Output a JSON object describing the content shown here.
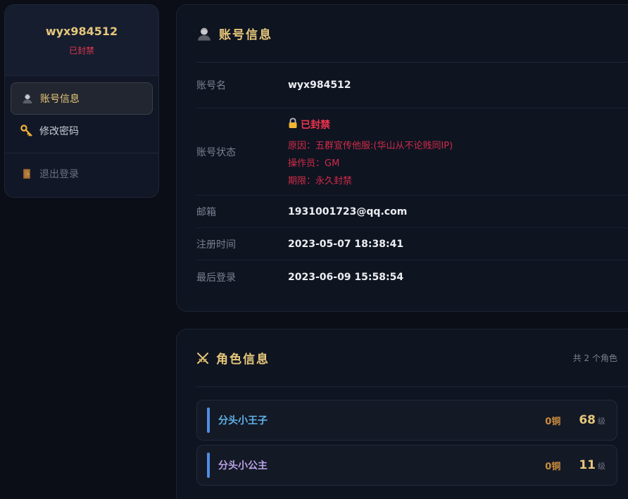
{
  "sidebar": {
    "username": "wyx984512",
    "status": "已封禁",
    "nav": [
      {
        "label": "账号信息",
        "icon": "user-avatar-icon"
      },
      {
        "label": "修改密码",
        "icon": "key-icon"
      }
    ],
    "logout_label": "退出登录"
  },
  "account": {
    "title": "账号信息",
    "rows": {
      "name": {
        "label": "账号名",
        "value": "wyx984512"
      },
      "status": {
        "label": "账号状态",
        "value": "已封禁",
        "reason": "原因：五群宣传他服:(华山从不论贱同IP)",
        "operator": "操作员：GM",
        "duration": "期限：永久封禁"
      },
      "email": {
        "label": "邮箱",
        "value": "1931001723@qq.com"
      },
      "registered": {
        "label": "注册时间",
        "value": "2023-05-07 18:38:41"
      },
      "last_login": {
        "label": "最后登录",
        "value": "2023-06-09 15:58:54"
      }
    }
  },
  "roles": {
    "title": "角色信息",
    "count_text": "共 2 个角色",
    "items": [
      {
        "name": "分头小王子",
        "copper": "0铜",
        "level": "68",
        "level_unit": "级"
      },
      {
        "name": "分头小公主",
        "copper": "0铜",
        "level": "11",
        "level_unit": "级"
      }
    ]
  },
  "colors": {
    "accent_gold": "#e6c77a",
    "danger": "#e0364e",
    "role_bar": "#4f8fe6",
    "role_name_1": "#5fb3e8",
    "role_name_2": "#b9a3e6"
  }
}
